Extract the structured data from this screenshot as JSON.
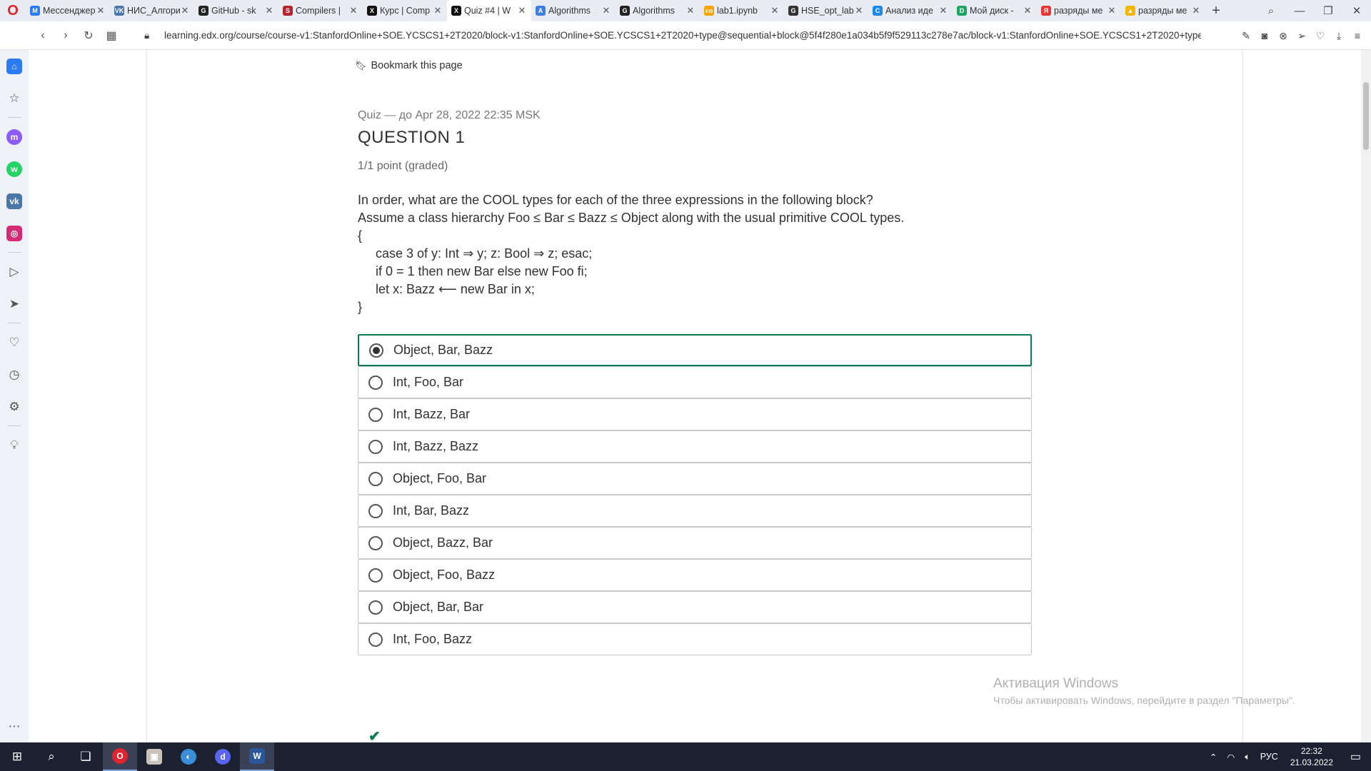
{
  "browser": {
    "tabs": [
      {
        "label": "Мессенджер",
        "color": "#2b7bf3",
        "glyph": "M",
        "active": false
      },
      {
        "label": "НИС_Алгоритмы",
        "color": "#4a76a8",
        "glyph": "VK",
        "active": false
      },
      {
        "label": "GitHub - sk",
        "color": "#222222",
        "glyph": "G",
        "active": false
      },
      {
        "label": "Compilers |",
        "color": "#b5242c",
        "glyph": "S",
        "active": false
      },
      {
        "label": "Курс | Comp",
        "color": "#111111",
        "glyph": "X",
        "active": false
      },
      {
        "label": "Quiz #4 | W",
        "color": "#111111",
        "glyph": "X",
        "active": true
      },
      {
        "label": "Algorithms",
        "color": "#3d7ee0",
        "glyph": "A",
        "active": false
      },
      {
        "label": "Algorithms",
        "color": "#222222",
        "glyph": "G",
        "active": false
      },
      {
        "label": "lab1.ipynb",
        "color": "#f4a300",
        "glyph": "co",
        "active": false
      },
      {
        "label": "HSE_opt_lab",
        "color": "#333333",
        "glyph": "G",
        "active": false
      },
      {
        "label": "Анализ иде",
        "color": "#1e88e5",
        "glyph": "C",
        "active": false
      },
      {
        "label": "Мой диск -",
        "color": "#1fa463",
        "glyph": "D",
        "active": false
      },
      {
        "label": "разряды ме",
        "color": "#e53935",
        "glyph": "Я",
        "active": false
      },
      {
        "label": "разряды ме",
        "color": "#f2b705",
        "glyph": "▲",
        "active": false
      }
    ],
    "close_glyph": "✕",
    "new_tab_glyph": "+",
    "url": "learning.edx.org/course/course-v1:StanfordOnline+SOE.YCSCS1+2T2020/block-v1:StanfordOnline+SOE.YCSCS1+2T2020+type@sequential+block@5f4f280e1a034b5f9f529113c278e7ac/block-v1:StanfordOnline+SOE.YCSCS1+2T2020+type@"
  },
  "page": {
    "bookmark_label": "Bookmark this page",
    "meta": "Quiz — до Apr 28, 2022 22:35 MSK",
    "title": "QUESTION 1",
    "points": "1/1 point (graded)",
    "prompt_lines": [
      "In order, what are the COOL types for each of the three expressions in the following block?",
      "Assume a class hierarchy Foo ≤ Bar ≤ Bazz ≤ Object along with the usual primitive COOL types.",
      "{",
      "case 3 of y: Int ⇒ y; z: Bool ⇒ z; esac;",
      "if 0 = 1 then new Bar else new Foo fi;",
      "let x: Bazz ⟵ new Bar in x;",
      "}"
    ],
    "options": [
      {
        "label": "Object, Bar, Bazz",
        "selected": true
      },
      {
        "label": "Int, Foo, Bar",
        "selected": false
      },
      {
        "label": "Int, Bazz, Bar",
        "selected": false
      },
      {
        "label": "Int, Bazz, Bazz",
        "selected": false
      },
      {
        "label": "Object, Foo, Bar",
        "selected": false
      },
      {
        "label": "Int, Bar, Bazz",
        "selected": false
      },
      {
        "label": "Object, Bazz, Bar",
        "selected": false
      },
      {
        "label": "Object, Foo, Bazz",
        "selected": false
      },
      {
        "label": "Object, Bar, Bar",
        "selected": false
      },
      {
        "label": "Int, Foo, Bazz",
        "selected": false
      }
    ],
    "correct_mark": "✔"
  },
  "watermark": {
    "line1": "Активация Windows",
    "line2": "Чтобы активировать Windows, перейдите в раздел \"Параметры\"."
  },
  "taskbar": {
    "lang": "РУС",
    "time": "22:32",
    "date": "21.03.2022"
  },
  "colors": {
    "selected_border": "#0d7d4d",
    "check": "#0d7d4d",
    "taskbar": "#1b2130"
  }
}
